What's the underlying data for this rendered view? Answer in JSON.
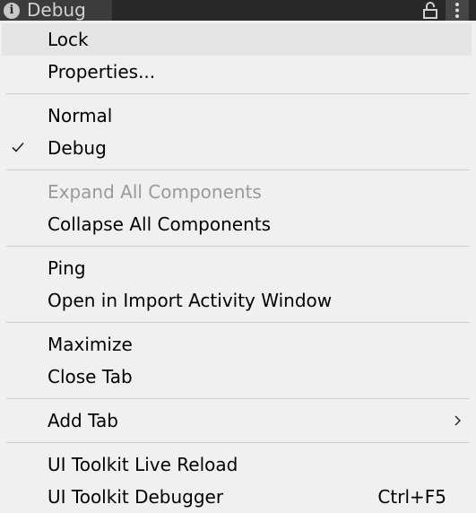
{
  "tab": {
    "icon": "info-icon",
    "icon_glyph": "i",
    "title": "Debug"
  },
  "menu": {
    "lock": "Lock",
    "properties": "Properties...",
    "normal": "Normal",
    "debug": "Debug",
    "expand_all": "Expand All Components",
    "collapse_all": "Collapse All Components",
    "ping": "Ping",
    "open_import_activity": "Open in Import Activity Window",
    "maximize": "Maximize",
    "close_tab": "Close Tab",
    "add_tab": "Add Tab",
    "ui_toolkit_live_reload": "UI Toolkit Live Reload",
    "ui_toolkit_debugger": "UI Toolkit Debugger",
    "ui_toolkit_debugger_shortcut": "Ctrl+F5"
  },
  "state": {
    "checked_item": "Debug",
    "disabled_items": [
      "Expand All Components"
    ],
    "highlighted_item": "Lock"
  },
  "colors": {
    "titlebar_bg": "#282828",
    "tab_bg": "#3c3c3c",
    "menu_bg": "#f0f0f0",
    "highlight_bg": "#e5e5e5",
    "disabled_text": "#9a9a9a"
  }
}
